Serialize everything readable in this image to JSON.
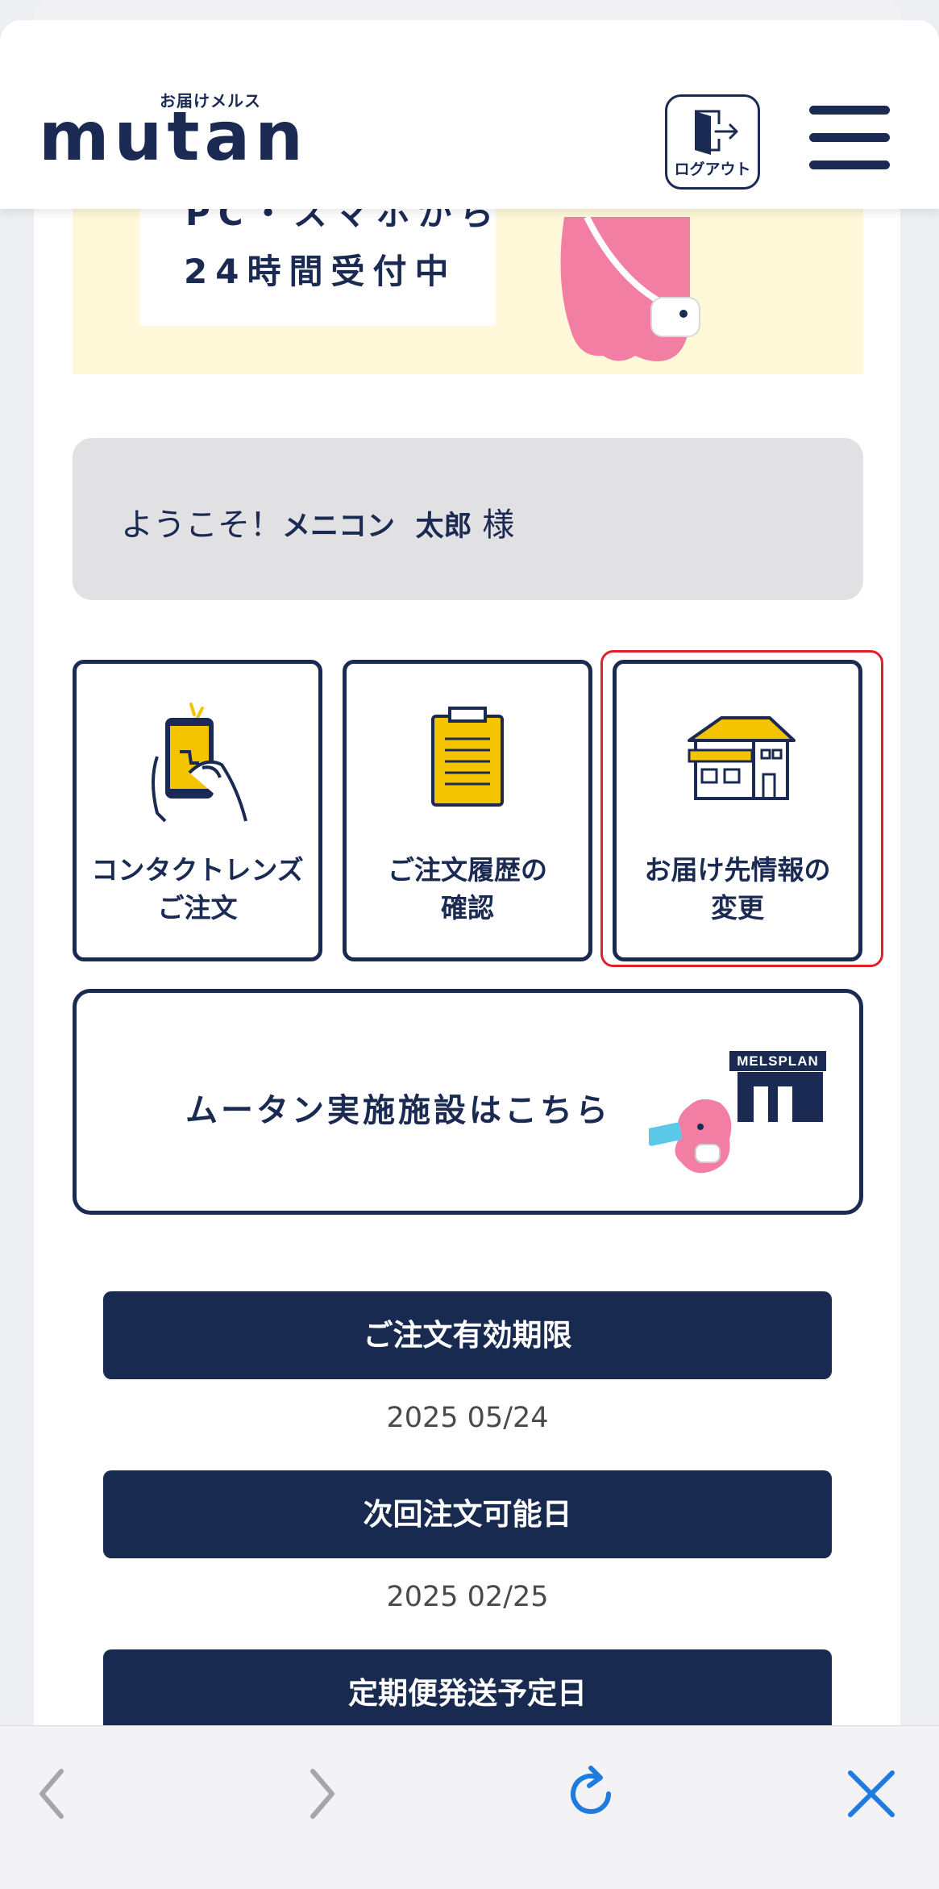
{
  "header": {
    "logo_sub": "お届けメルス",
    "logo_main": "mutan",
    "logout_label": "ログアウト"
  },
  "banner": {
    "partial_text": "PC・スマホから",
    "text": "24時間受付中"
  },
  "welcome": {
    "prefix": "ようこそ！",
    "last_name": "メニコン",
    "first_name": "太郎",
    "suffix": "様"
  },
  "tiles": [
    {
      "line1": "コンタクトレンズ",
      "line2": "ご注文"
    },
    {
      "line1": "ご注文履歴の",
      "line2": "確認"
    },
    {
      "line1": "お届け先情報の",
      "line2": "変更"
    }
  ],
  "facility": {
    "label": "ムータン実施施設はこちら",
    "sign": "MELSPLAN"
  },
  "info": [
    {
      "label": "ご注文有効期限",
      "value": "2025 05/24"
    },
    {
      "label": "次回注文可能日",
      "value": "2025 02/25"
    },
    {
      "label": "定期便発送予定日"
    }
  ],
  "colors": {
    "navy": "#1a2a52",
    "accent_yellow": "#f5c400",
    "highlight_red": "#e0202a",
    "banner_bg": "#fff8d9",
    "browser_blue": "#1e7be0"
  },
  "icons": {
    "logout": "logout-door-icon",
    "menu": "hamburger-menu-icon",
    "back": "chevron-left-icon",
    "forward": "chevron-right-icon",
    "reload": "reload-icon",
    "close": "close-icon"
  }
}
